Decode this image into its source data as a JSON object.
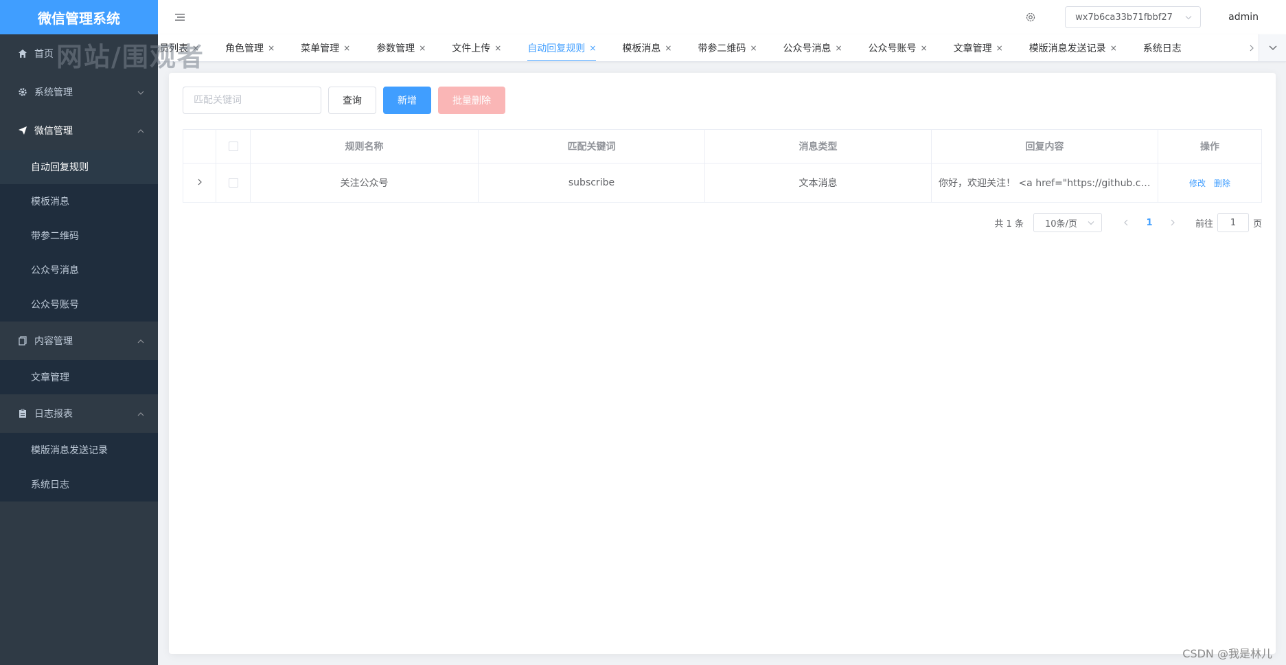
{
  "app": {
    "title": "微信管理系统",
    "accent_color": "#409eff",
    "sidebar_bg": "#2f3a45",
    "danger_disabled_color": "#fab6b6"
  },
  "sidebar": {
    "items": [
      {
        "label": "首页",
        "icon": "home-icon"
      },
      {
        "label": "系统管理",
        "icon": "gear-icon",
        "arrow": "chevron-down-icon"
      },
      {
        "label": "微信管理",
        "icon": "send-icon",
        "arrow": "chevron-up-icon",
        "children": [
          "自动回复规则",
          "模板消息",
          "带参二维码",
          "公众号消息",
          "公众号账号"
        ]
      },
      {
        "label": "内容管理",
        "icon": "copy-icon",
        "arrow": "chevron-up-icon",
        "children": [
          "文章管理"
        ]
      },
      {
        "label": "日志报表",
        "icon": "clipboard-icon",
        "arrow": "chevron-up-icon",
        "children": [
          "模版消息发送记录",
          "系统日志"
        ]
      }
    ]
  },
  "header": {
    "account": "wx7b6ca33b71fbbf27",
    "user": "admin"
  },
  "tabs": {
    "items": [
      "退员列表",
      "角色管理",
      "菜单管理",
      "参数管理",
      "文件上传",
      "自动回复规则",
      "模板消息",
      "带参二维码",
      "公众号消息",
      "公众号账号",
      "文章管理",
      "模版消息发送记录",
      "系统日志"
    ],
    "active": "自动回复规则",
    "close_glyph": "×"
  },
  "toolbar": {
    "search_placeholder": "匹配关键词",
    "query_label": "查询",
    "add_label": "新增",
    "batch_delete_label": "批量删除"
  },
  "table": {
    "columns": [
      "规则名称",
      "匹配关键词",
      "消息类型",
      "回复内容",
      "操作"
    ],
    "rows": [
      {
        "name": "关注公众号",
        "keyword": "subscribe",
        "type": "文本消息",
        "content": "你好，欢迎关注！ <a href=\"https://github.com/niefy/wx-manage\">点击菜单体验</a>",
        "edit": "修改",
        "delete": "删除"
      }
    ]
  },
  "pagination": {
    "total": "共 1 条",
    "page_size": "10条/页",
    "current": "1",
    "goto_prefix": "前往",
    "goto_value": "1",
    "goto_suffix": "页"
  },
  "watermarks": {
    "top": "网站/围观者",
    "bottom": "CSDN @我是林儿"
  }
}
